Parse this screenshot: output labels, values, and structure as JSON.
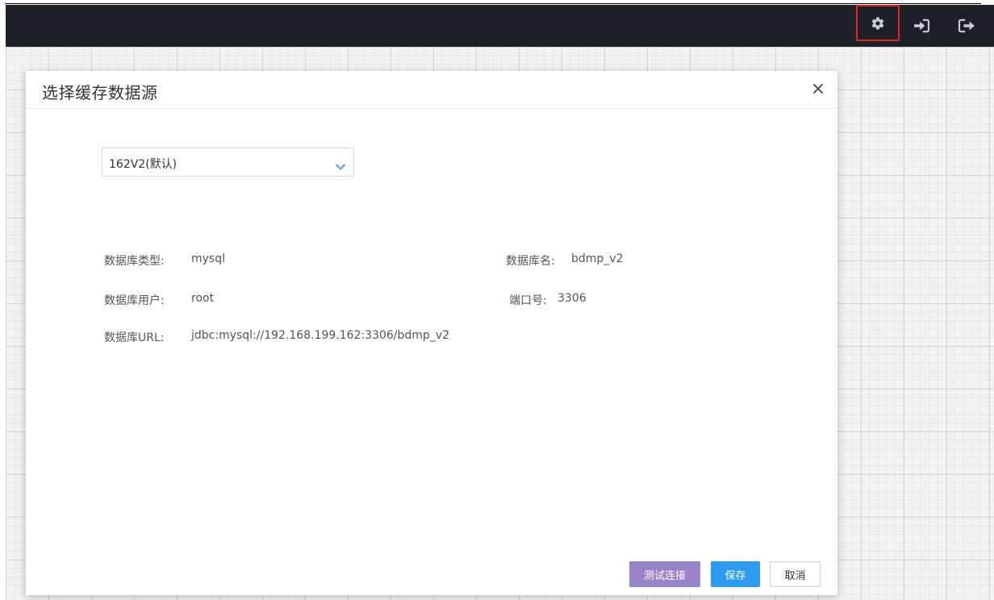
{
  "topbar": {
    "icons": [
      {
        "name": "gear-icon",
        "highlighted": true
      },
      {
        "name": "sign-in-icon",
        "highlighted": false
      },
      {
        "name": "sign-out-icon",
        "highlighted": false
      }
    ],
    "highlight_color": "#e0241b"
  },
  "dialog": {
    "title": "选择缓存数据源",
    "close_glyph": "✕",
    "datasource_select": {
      "value": "162V2(默认)"
    },
    "fields": {
      "db_type_label": "数据库类型:",
      "db_type_value": "mysql",
      "db_name_label": "数据库名:",
      "db_name_value": "bdmp_v2",
      "db_user_label": "数据库用户:",
      "db_user_value": "root",
      "port_label": "端口号:",
      "port_value": "3306",
      "db_url_label": "数据库URL:",
      "db_url_value": "jdbc:mysql://192.168.199.162:3306/bdmp_v2"
    },
    "buttons": {
      "test_label": "测试连接",
      "save_label": "保存",
      "cancel_label": "取消"
    }
  },
  "colors": {
    "topbar_bg": "#1c2127",
    "test_button": "#9a83c8",
    "save_button": "#2d9cf0",
    "select_arrow": "#4aa6e8"
  }
}
